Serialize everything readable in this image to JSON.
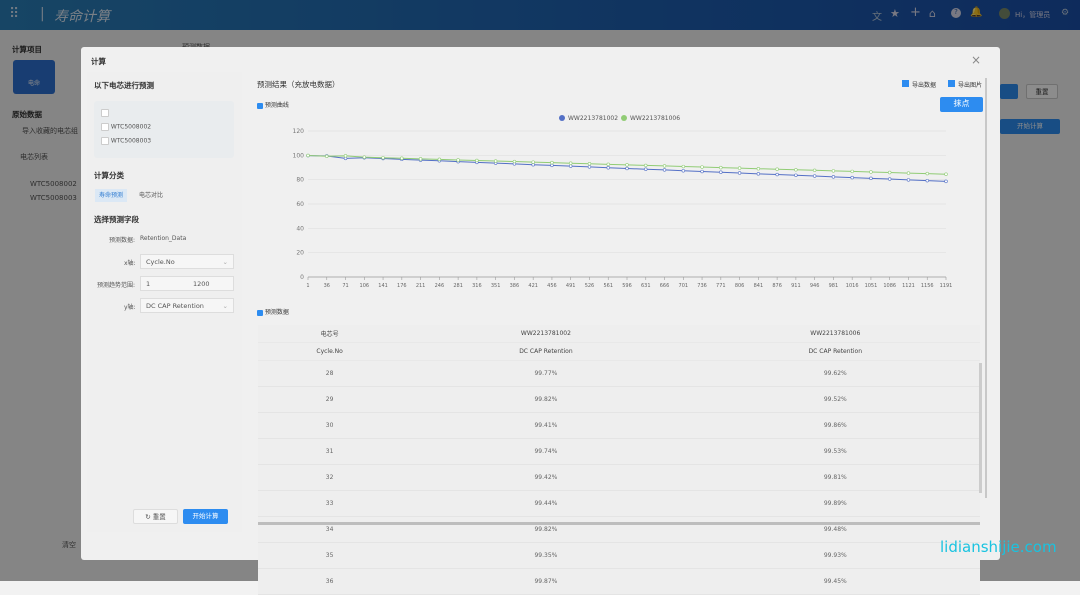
{
  "app": {
    "title": "寿命计算",
    "user": "Hi，管理员"
  },
  "background": {
    "section_calc": "计算项目",
    "item_life": "电命",
    "section_raw": "原始数据",
    "import_label": "导入收藏的电芯组",
    "cell_list_title": "电芯列表",
    "cells": [
      "WTC5008002",
      "WTC5008003"
    ],
    "right_title": "预测数据",
    "start_calc": "开始计算",
    "reset": "重置",
    "refresh": "清空"
  },
  "modal": {
    "title": "计算",
    "close": "×",
    "left": {
      "predict_title": "以下电芯进行预测",
      "cells": [
        "",
        "WTC5008002",
        "WTC5008003"
      ],
      "category_title": "计算分类",
      "tabs": [
        {
          "label": "寿命预测",
          "active": true
        },
        {
          "label": "电芯对比",
          "active": false
        }
      ],
      "field_title": "选择预测字段",
      "predict_data_label": "预测数据:",
      "predict_data_value": "Retention_Data",
      "x_label": "x轴:",
      "x_value": "Cycle.No",
      "range_label": "预测趋势范围:",
      "range_from": "1",
      "range_to": "1200",
      "y_label": "y轴:",
      "y_value": "DC CAP Retention",
      "reset": "重置",
      "start": "开始计算"
    },
    "right": {
      "title": "预测结果（充放电数据）",
      "export_data": "导出数据",
      "export_image": "导出图片",
      "curve_checkbox": "预测曲线",
      "data_checkbox": "预测数据",
      "mark_button": "抹点"
    },
    "table": {
      "header1": [
        "电芯号",
        "WW2213781002",
        "WW2213781006"
      ],
      "header2": [
        "Cycle.No",
        "DC CAP Retention",
        "DC CAP Retention"
      ],
      "rows": [
        [
          "28",
          "99.77%",
          "99.62%"
        ],
        [
          "29",
          "99.82%",
          "99.52%"
        ],
        [
          "30",
          "99.41%",
          "99.86%"
        ],
        [
          "31",
          "99.74%",
          "99.53%"
        ],
        [
          "32",
          "99.42%",
          "99.81%"
        ],
        [
          "33",
          "99.44%",
          "99.89%"
        ],
        [
          "34",
          "99.82%",
          "99.48%"
        ],
        [
          "35",
          "99.35%",
          "99.93%"
        ],
        [
          "36",
          "99.87%",
          "99.45%"
        ]
      ]
    }
  },
  "watermark": "lidianshijie.com",
  "chart_data": {
    "type": "line",
    "legend_position": "top-center",
    "grid": true,
    "ylim": [
      0,
      120
    ],
    "yticks": [
      0,
      20,
      40,
      60,
      80,
      100,
      120
    ],
    "x": [
      1,
      36,
      71,
      106,
      141,
      176,
      211,
      246,
      281,
      316,
      351,
      386,
      421,
      456,
      491,
      526,
      561,
      596,
      631,
      666,
      701,
      736,
      771,
      806,
      841,
      876,
      911,
      946,
      981,
      1016,
      1051,
      1086,
      1121,
      1156,
      1191
    ],
    "series": [
      {
        "name": "WW2213781002",
        "color": "#5470c6",
        "values": [
          99.8,
          99.5,
          97.5,
          98.0,
          97.4,
          96.7,
          96.1,
          95.5,
          94.8,
          94.2,
          93.6,
          93.0,
          92.3,
          91.7,
          91.1,
          90.5,
          89.8,
          89.2,
          88.6,
          88.0,
          87.3,
          86.7,
          86.1,
          85.5,
          84.8,
          84.2,
          83.6,
          83.0,
          82.3,
          81.7,
          81.1,
          80.5,
          79.8,
          79.2,
          78.6
        ]
      },
      {
        "name": "WW2213781006",
        "color": "#91cc75",
        "values": [
          99.9,
          99.2,
          99.6,
          98.5,
          98.0,
          97.6,
          97.1,
          96.7,
          96.2,
          95.8,
          95.3,
          94.9,
          94.4,
          94.0,
          93.5,
          93.1,
          92.6,
          92.2,
          91.7,
          91.3,
          90.8,
          90.4,
          89.9,
          89.5,
          89.0,
          88.6,
          88.1,
          87.7,
          87.2,
          86.8,
          86.3,
          85.9,
          85.4,
          85.0,
          84.5
        ]
      }
    ]
  }
}
